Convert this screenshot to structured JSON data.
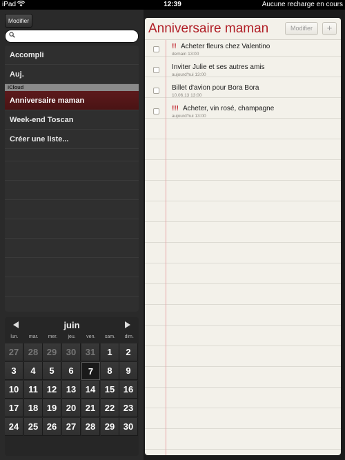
{
  "status_bar": {
    "carrier": "iPad",
    "wifi_icon": "wifi-icon",
    "time": "12:39",
    "battery_text": "Aucune recharge en cours"
  },
  "sidebar": {
    "edit_label": "Modifier",
    "search": {
      "placeholder": "",
      "value": ""
    },
    "lists": [
      {
        "label": "Accompli"
      },
      {
        "label": "Auj."
      }
    ],
    "section_label": "iCloud",
    "cloud_lists": [
      {
        "label": "Anniversaire maman",
        "selected": true
      },
      {
        "label": "Week-end Toscan"
      },
      {
        "label": "Créer une liste..."
      }
    ]
  },
  "calendar": {
    "month": "juin",
    "prev_icon": "chevron-left-icon",
    "next_icon": "chevron-right-icon",
    "weekdays": [
      "lun.",
      "mar.",
      "mer.",
      "jeu.",
      "ven.",
      "sam.",
      "dim."
    ],
    "weeks": [
      [
        "27",
        "28",
        "29",
        "30",
        "31",
        "1",
        "2"
      ],
      [
        "3",
        "4",
        "5",
        "6",
        "7",
        "8",
        "9"
      ],
      [
        "10",
        "11",
        "12",
        "13",
        "14",
        "15",
        "16"
      ],
      [
        "17",
        "18",
        "19",
        "20",
        "21",
        "22",
        "23"
      ],
      [
        "24",
        "25",
        "26",
        "27",
        "28",
        "29",
        "30"
      ]
    ],
    "today": "7"
  },
  "main": {
    "title": "Anniversaire maman",
    "edit_label": "Modifier",
    "add_label": "+",
    "tasks": [
      {
        "priority": "!!",
        "title": "Acheter fleurs chez Valentino",
        "date": "demain 13:00"
      },
      {
        "priority": "",
        "title": "Inviter Julie et ses autres amis",
        "date": "aujourd'hui 13:00"
      },
      {
        "priority": "",
        "title": "Billet d'avion pour Bora Bora",
        "date": "10.06.13 13:00"
      },
      {
        "priority": "!!!",
        "title": "Acheter, vin rosé, champagne",
        "date": "aujourd'hui 13:00"
      }
    ]
  },
  "colors": {
    "accent": "#b01e26",
    "selected_row": "#5c1a1c",
    "paper": "#f3f1ea"
  }
}
